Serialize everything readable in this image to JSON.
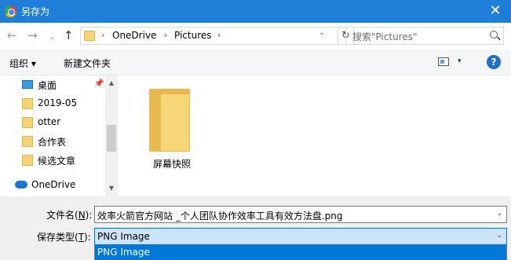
{
  "titlebar": {
    "title": "另存为",
    "close": "✕"
  },
  "nav": {
    "back": "←",
    "forward": "→",
    "recent": "⌄",
    "up": "↑",
    "breadcrumb": [
      "OneDrive",
      "Pictures"
    ],
    "sep": "›",
    "addr_dropdown": "⌄",
    "refresh": "↻",
    "search_placeholder": "搜索\"Pictures\""
  },
  "toolbar": {
    "organize": "组织 ▾",
    "new_folder": "新建文件夹",
    "view_dd": "▾",
    "help": "?"
  },
  "sidebar": {
    "items": [
      {
        "label": "桌面",
        "icon": "desktop-icon"
      },
      {
        "label": "2019-05",
        "icon": "folder-icon"
      },
      {
        "label": "otter",
        "icon": "folder-icon"
      },
      {
        "label": "合作表",
        "icon": "folder-icon"
      },
      {
        "label": "候选文章",
        "icon": "folder-icon"
      },
      {
        "label": "OneDrive",
        "icon": "cloud-icon"
      }
    ],
    "pin": "📌",
    "scroll_up": "▲",
    "scroll_down": "▼"
  },
  "content": {
    "folders": [
      {
        "label": "屏幕快照"
      }
    ]
  },
  "bottom": {
    "filename_label": "文件名(",
    "filename_key": "N",
    "filename_label_end": "):",
    "filename_value": "效率火箭官方网站 _个人团队协作效率工具有效方法盘.png",
    "type_label": "保存类型(",
    "type_key": "T",
    "type_label_end": "):",
    "type_value": "PNG Image",
    "dropdown": "⌄",
    "options": [
      "PNG Image"
    ]
  }
}
